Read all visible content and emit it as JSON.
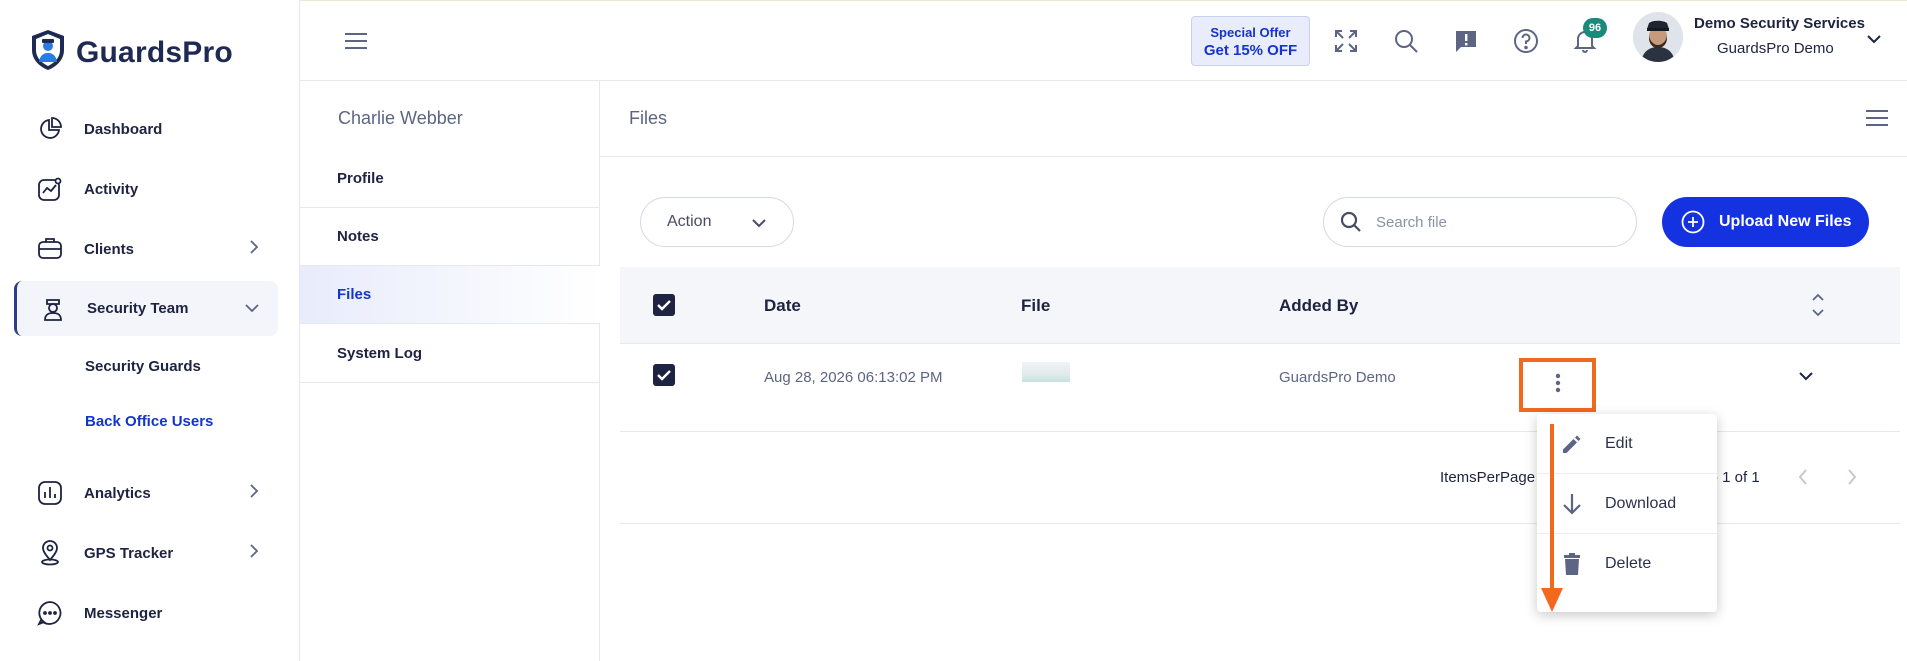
{
  "brand": {
    "name": "GuardsPro"
  },
  "sidebar": {
    "items": [
      {
        "label": "Dashboard",
        "icon": "dashboard-icon"
      },
      {
        "label": "Activity",
        "icon": "activity-icon"
      },
      {
        "label": "Clients",
        "icon": "clients-icon"
      },
      {
        "label": "Security Team",
        "icon": "security-team-icon"
      },
      {
        "label": "Analytics",
        "icon": "analytics-icon"
      },
      {
        "label": "GPS Tracker",
        "icon": "gps-tracker-icon"
      },
      {
        "label": "Messenger",
        "icon": "messenger-icon"
      }
    ],
    "sub_items": [
      {
        "label": "Security Guards"
      },
      {
        "label": "Back Office Users"
      }
    ]
  },
  "topbar": {
    "offer_line1": "Special Offer",
    "offer_line2": "Get 15% OFF",
    "notification_count": "96",
    "user_name": "Demo Security Services",
    "user_org": "GuardsPro Demo"
  },
  "profile_panel": {
    "name": "Charlie Webber",
    "tabs": [
      {
        "label": "Profile"
      },
      {
        "label": "Notes"
      },
      {
        "label": "Files"
      },
      {
        "label": "System Log"
      }
    ]
  },
  "files": {
    "title": "Files",
    "action_label": "Action",
    "search_placeholder": "Search file",
    "upload_label": "Upload New Files",
    "columns": {
      "date": "Date",
      "file": "File",
      "added_by": "Added By"
    },
    "rows": [
      {
        "date": "Aug 28, 2026 06:13:02 PM",
        "added_by": "GuardsPro Demo"
      }
    ],
    "pager": {
      "items_per_page": "ItemsPerPage",
      "range": "- 1 of 1"
    }
  },
  "row_menu": {
    "items": [
      {
        "label": "Edit",
        "icon": "edit-icon"
      },
      {
        "label": "Download",
        "icon": "download-icon"
      },
      {
        "label": "Delete",
        "icon": "delete-icon"
      }
    ]
  },
  "colors": {
    "primary": "#1432e0",
    "highlight": "#f2681f",
    "badge": "#1a8a7a",
    "text_dark": "#1d2340",
    "text_muted": "#5c6584"
  }
}
